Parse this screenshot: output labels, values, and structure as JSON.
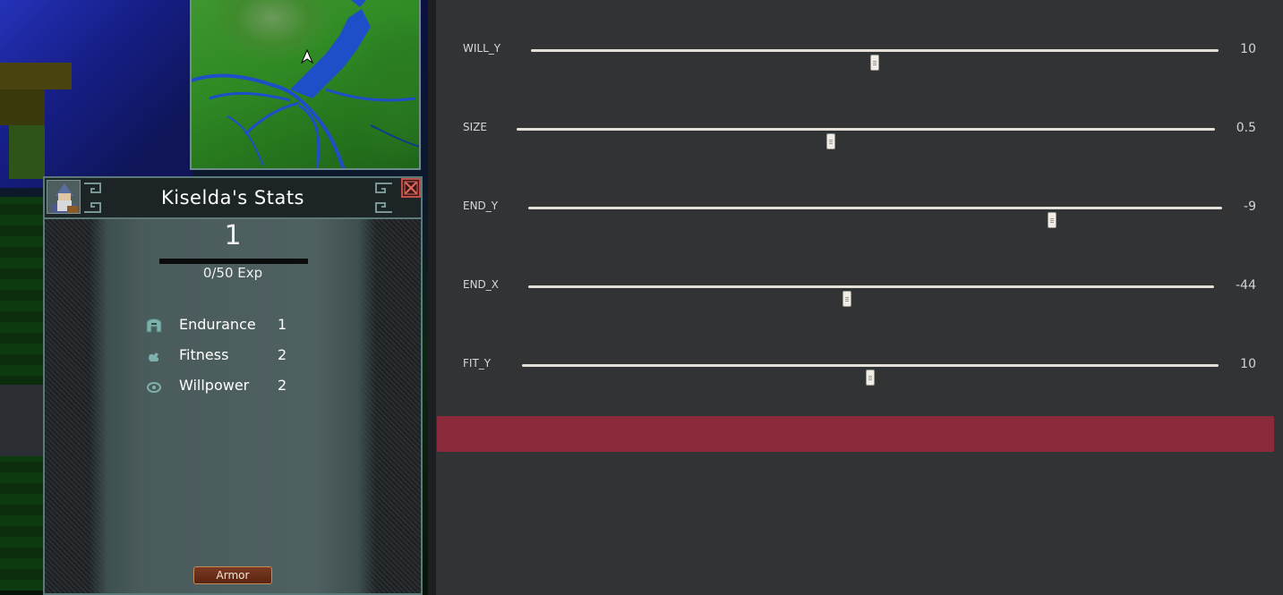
{
  "game": {
    "panel": {
      "title": "Kiselda's Stats",
      "level": "1",
      "exp_text": "0/50 Exp",
      "exp_progress": 0,
      "stats": [
        {
          "label": "Endurance",
          "value": "1",
          "icon": "helmet-icon"
        },
        {
          "label": "Fitness",
          "value": "2",
          "icon": "flexed-arm-icon"
        },
        {
          "label": "Willpower",
          "value": "2",
          "icon": "eye-icon"
        }
      ],
      "armor_button": "Armor"
    },
    "colors": {
      "panel_border": "#5a7978",
      "close_button": "#c0504a",
      "armor_button": "#6a2e18"
    }
  },
  "controls": {
    "sliders": [
      {
        "label": "WILL_Y",
        "value": "10",
        "position": 0.5
      },
      {
        "label": "SIZE",
        "value": "0.5",
        "position": 0.45
      },
      {
        "label": "END_Y",
        "value": "-9",
        "position": 0.755
      },
      {
        "label": "END_X",
        "value": "-44",
        "position": 0.465
      },
      {
        "label": "FIT_Y",
        "value": "10",
        "position": 0.5
      }
    ],
    "colors": {
      "background": "#313335",
      "track": "#e4e0d8",
      "action_bar": "#8b2a3b"
    }
  }
}
